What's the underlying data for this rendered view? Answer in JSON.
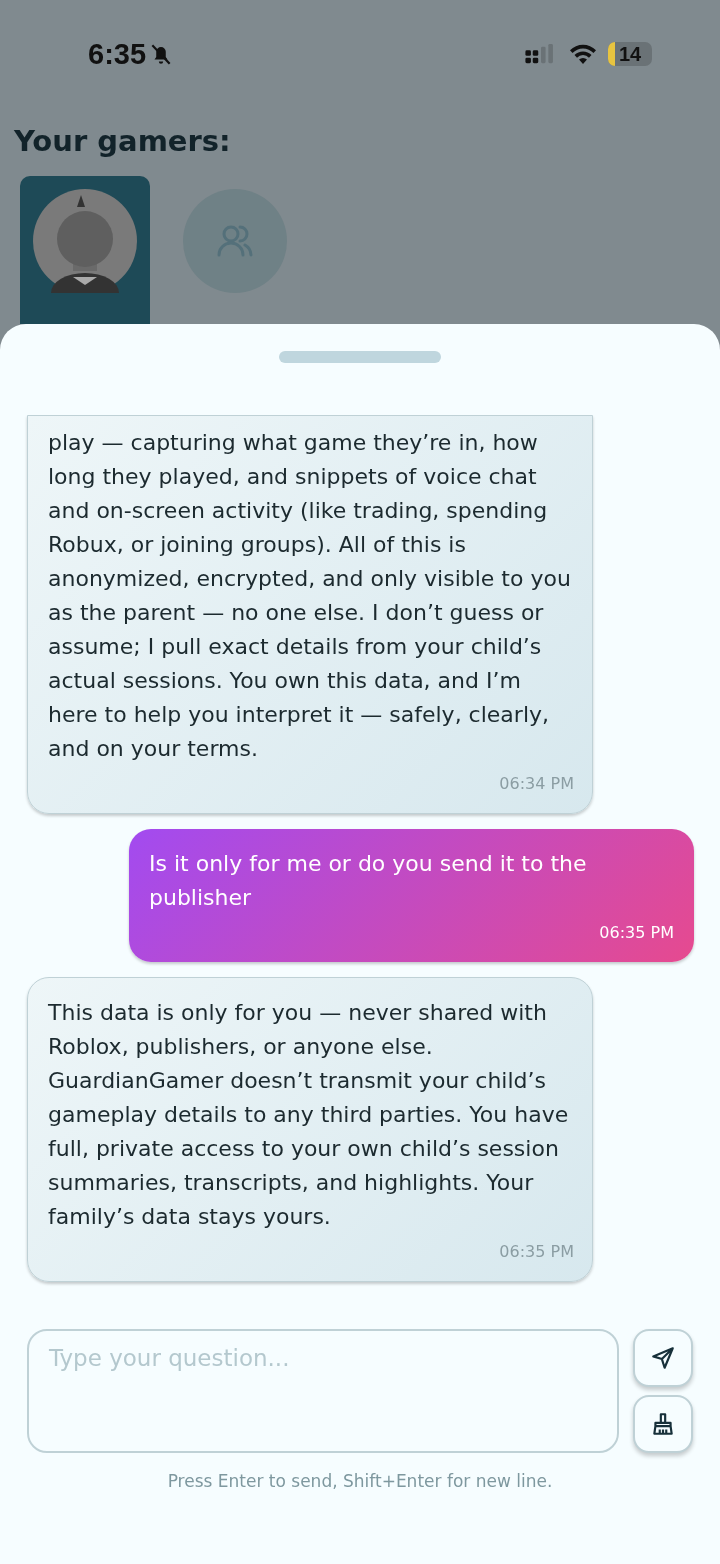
{
  "status_bar": {
    "time": "6:35",
    "battery": "14"
  },
  "heading": "Your gamers:",
  "gamers": [
    {
      "kind": "avatar",
      "selected": true
    },
    {
      "kind": "group",
      "selected": false
    }
  ],
  "messages": [
    {
      "kind": "bot",
      "continued": true,
      "text": "play — capturing what game they’re in, how long they played, and snippets of voice chat and on-screen activity (like trading, spending Robux, or joining groups). All of this is anonymized, encrypted, and only visible to you as the parent — no one else. I don’t guess or assume; I pull exact details from your child’s actual sessions. You own this data, and I’m here to help you interpret it — safely, clearly, and on your terms.",
      "time": "06:34 PM"
    },
    {
      "kind": "user",
      "continued": false,
      "text": "Is it only for me or do you send it to the publisher",
      "time": "06:35 PM"
    },
    {
      "kind": "bot",
      "continued": false,
      "text": "This data is only for you — never shared with Roblox, publishers, or anyone else. GuardianGamer doesn’t transmit your child’s gameplay details to any third parties. You have full, private access to your own child’s session summaries, transcripts, and highlights. Your family’s data stays yours.",
      "time": "06:35 PM"
    }
  ],
  "input": {
    "placeholder": "Type your question..."
  },
  "hint": "Press Enter to send, Shift+Enter for new line."
}
